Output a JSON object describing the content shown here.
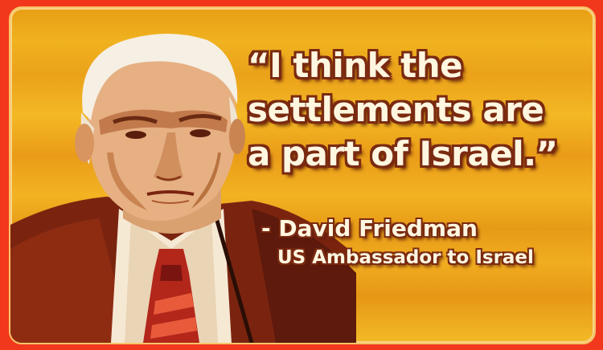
{
  "quote": {
    "lines": [
      "“I think the",
      "settlements are",
      "a part of Israel.”"
    ]
  },
  "attribution": {
    "name": "- David Friedman",
    "title": "US Ambassador to Israel"
  },
  "colors": {
    "border": "#f2381c",
    "background": "#f0b21f",
    "text": "#fff6e0",
    "text_outline": "#7a2a10"
  }
}
